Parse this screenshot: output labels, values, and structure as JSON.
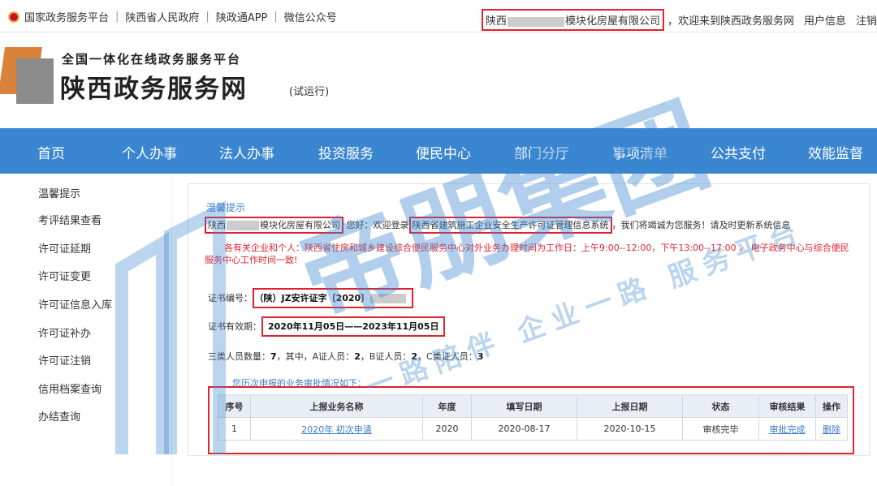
{
  "topbar": {
    "links": [
      "国家政务服务平台",
      "陕西省人民政府",
      "陕政通APP",
      "微信公众号"
    ],
    "sep": "|",
    "company_prefix": "陕西",
    "company_suffix": "模块化房屋有限公司",
    "welcome": "，欢迎来到陕西政务服务网",
    "user_info": "用户信息",
    "logout": "注销"
  },
  "header": {
    "subtitle": "全国一体化在线政务服务平台",
    "title": "陕西政务服务网",
    "trial": "(试运行)"
  },
  "nav": [
    "首页",
    "个人办事",
    "法人办事",
    "投资服务",
    "便民中心",
    "部门分厅",
    "事项清单",
    "公共支付",
    "效能监督"
  ],
  "sidebar": [
    "温馨提示",
    "考评结果查看",
    "许可证延期",
    "许可证变更",
    "许可证信息入库",
    "许可证补办",
    "许可证注销",
    "信用档案查询",
    "办结查询"
  ],
  "panel": {
    "tip_title": "温馨提示",
    "company_prefix": "陕西",
    "company_suffix": "模块化房屋有限公司",
    "hello": "您好：欢迎登录",
    "system_name": "陕西省建筑施工企业安全生产许可证管理信息系统",
    "thanks": "，我们将竭诚为您服务！请及时更新系统信息",
    "notice": "各有关企业和个人：陕西省住房和城乡建设综合便民服务中心对外业务办理时间为工作日：上午9:00--12:00，下午13:00--17:00 。 电子政务中心与综合便民服务中心工作时间一致!",
    "cert_no_label": "证书编号：",
    "cert_no": "（陕）JZ安许证字〔2020〕",
    "cert_valid_label": "证书有效期：",
    "cert_valid": "2020年11月05日——2023年11月05日",
    "persons_label": "三类人员数量：",
    "persons_total": "7",
    "persons_mid": "，其中，A证人员：",
    "persons_a": "2",
    "persons_b_label": "，B证人员：",
    "persons_b": "2",
    "persons_c_label": "，C类证人员：",
    "persons_c": "3",
    "history": "您历次申报的业务审批情况如下："
  },
  "table": {
    "headers": [
      "序号",
      "上报业务名称",
      "年度",
      "填写日期",
      "上报日期",
      "状态",
      "审核结果",
      "操作"
    ],
    "rows": [
      {
        "no": "1",
        "name": "2020年 初次申请",
        "year": "2020",
        "fill_date": "2020-08-17",
        "report_date": "2020-10-15",
        "status": "审核完毕",
        "result": "审批完成",
        "action": "删除"
      }
    ]
  },
  "watermark": {
    "brand": "帝朋集团",
    "slogan": "一路陪伴 企业一路 服务平台",
    "color": "#3b86d0"
  },
  "colors": {
    "nav_bg": "#3b86d0",
    "highlight": "#e0222f",
    "notice": "#e0222f",
    "link": "#3b7bc8"
  }
}
